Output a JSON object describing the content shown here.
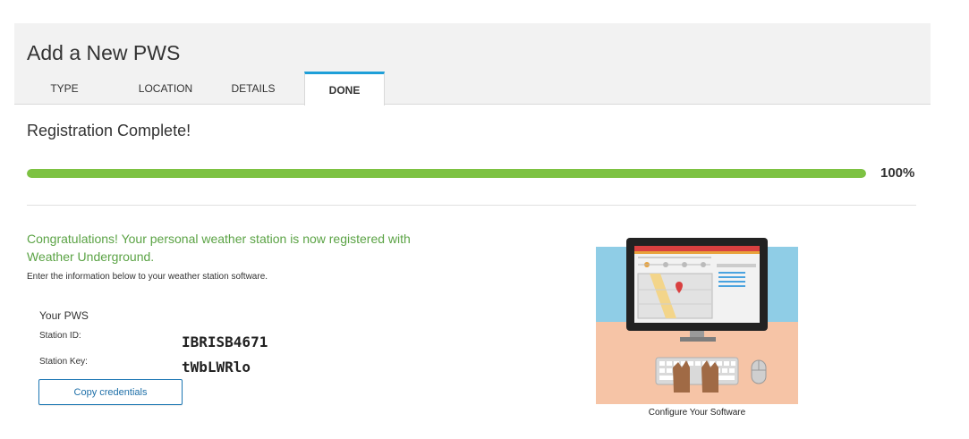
{
  "header": {
    "title": "Add a New PWS",
    "tabs": [
      {
        "label": "TYPE",
        "active": false
      },
      {
        "label": "LOCATION",
        "active": false
      },
      {
        "label": "DETAILS",
        "active": false
      },
      {
        "label": "DONE",
        "active": true
      }
    ]
  },
  "main": {
    "section_title": "Registration Complete!",
    "progress": {
      "fraction": 1.0,
      "label": "100%"
    },
    "congrats": "Congratulations! Your personal weather station is now registered with Weather Underground.",
    "instructions": "Enter the information below to your weather station software.",
    "pws": {
      "heading": "Your PWS",
      "station_id_label": "Station ID:",
      "station_id": "IBRISB4671",
      "station_key_label": "Station Key:",
      "station_key": "tWbLWRlo",
      "copy_button": "Copy credentials"
    },
    "illustration": {
      "caption": "Configure Your Software",
      "icon": "computer-setup-illustration"
    }
  },
  "colors": {
    "accent": "#1e9fd8",
    "progress": "#7dc242",
    "congrats_text": "#5ba345",
    "button_border": "#1e78b4"
  }
}
